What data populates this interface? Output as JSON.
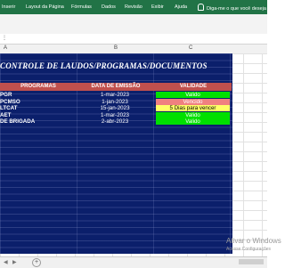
{
  "ribbon": {
    "tabs": [
      "Inserir",
      "Layout da Página",
      "Fórmulas",
      "Dados",
      "Revisão",
      "Exibir",
      "Ajuda"
    ],
    "tell_me": "Diga-me o que você deseja fazer"
  },
  "columns": [
    "A",
    "B",
    "C"
  ],
  "sheet": {
    "title": "CONTROLE DE LAUDOS/PROGRAMAS/DOCUMENTOS",
    "headers": [
      "PROGRAMAS",
      "DATA DE EMISSÃO",
      "VALIDADE"
    ],
    "rows": [
      {
        "name": "PGR",
        "date": "1-mar-2023",
        "status": "Valido",
        "color": "#00e000"
      },
      {
        "name": "PCMSO",
        "date": "1-jan-2023",
        "status": "Vencido",
        "color": "#f08080"
      },
      {
        "name": "LTCAT",
        "date": "15-jan-2023",
        "status": "5 Dias para vencer",
        "color": "#ffff66"
      },
      {
        "name": "AET",
        "date": "1-mar-2023",
        "status": "Valido",
        "color": "#00e000"
      },
      {
        "name": "DE BRIGADA",
        "date": "2-abr-2023",
        "status": "Valido",
        "color": "#00e000"
      }
    ]
  },
  "watermark": {
    "line1": "Ativar o Windows",
    "line2": "Acesse Configurações"
  },
  "colors": {
    "ribbon": "#217346",
    "table_bg": "#0b1f6b",
    "header_bg": "#c0504d"
  }
}
